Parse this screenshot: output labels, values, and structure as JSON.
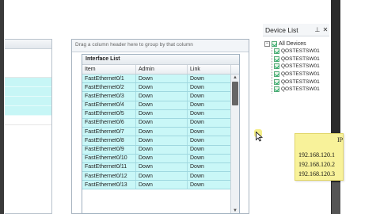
{
  "interface_grid": {
    "group_hint": "Drag a column header here to group by that column",
    "title": "Interface List",
    "columns": [
      "Item",
      "Admin",
      "Link"
    ],
    "rows": [
      {
        "item": "FastEthernet0/1",
        "admin": "Down",
        "link": "Down"
      },
      {
        "item": "FastEthernet0/2",
        "admin": "Down",
        "link": "Down"
      },
      {
        "item": "FastEthernet0/3",
        "admin": "Down",
        "link": "Down"
      },
      {
        "item": "FastEthernet0/4",
        "admin": "Down",
        "link": "Down"
      },
      {
        "item": "FastEthernet0/5",
        "admin": "Down",
        "link": "Down"
      },
      {
        "item": "FastEthernet0/6",
        "admin": "Down",
        "link": "Down"
      },
      {
        "item": "FastEthernet0/7",
        "admin": "Down",
        "link": "Down"
      },
      {
        "item": "FastEthernet0/8",
        "admin": "Down",
        "link": "Down"
      },
      {
        "item": "FastEthernet0/9",
        "admin": "Down",
        "link": "Down"
      },
      {
        "item": "FastEthernet0/10",
        "admin": "Down",
        "link": "Down"
      },
      {
        "item": "FastEthernet0/11",
        "admin": "Down",
        "link": "Down"
      },
      {
        "item": "FastEthernet0/12",
        "admin": "Down",
        "link": "Down"
      },
      {
        "item": "FastEthernet0/13",
        "admin": "Down",
        "link": "Down"
      }
    ]
  },
  "device_list": {
    "title": "Device List",
    "pin_glyph": "⊥",
    "close_glyph": "✕",
    "root_label": "All Devices",
    "expander": "−",
    "devices": [
      "QOSTESTSW01",
      "QOSTESTSW01",
      "QOSTESTSW01",
      "QOSTESTSW01",
      "QOSTESTSW01",
      "QOSTESTSW01"
    ]
  },
  "note": {
    "label": "IP",
    "lines": [
      "192.168.120.1",
      "192.168.120.2",
      "192.168.120.3"
    ]
  },
  "colors": {
    "row_cyan": "#c9f7f7",
    "note_yellow": "#f8f29a"
  }
}
